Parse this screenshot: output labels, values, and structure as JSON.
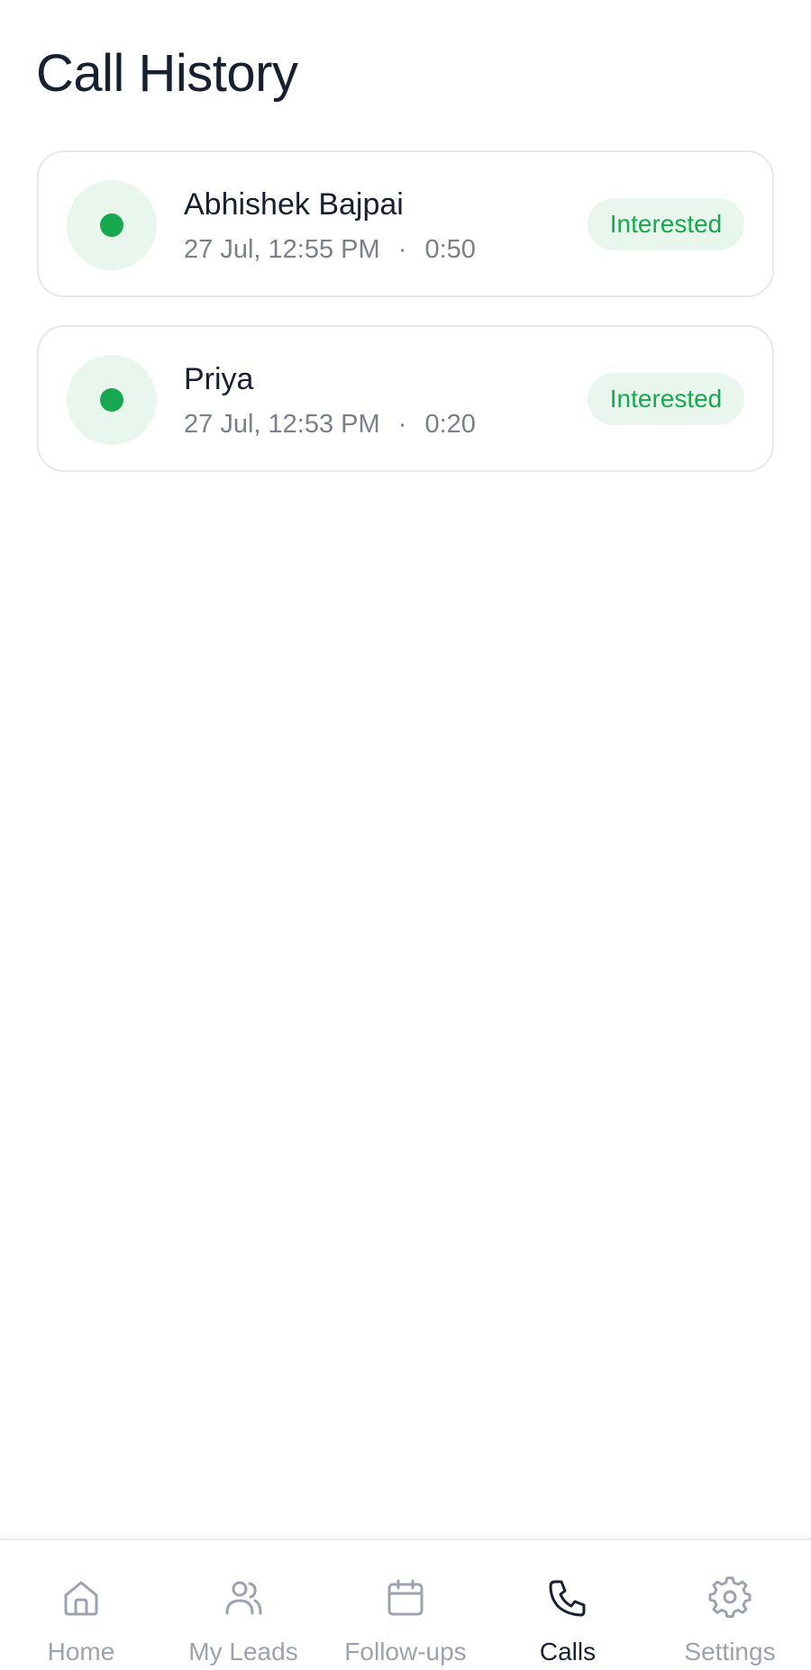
{
  "page": {
    "title": "Call History"
  },
  "colors": {
    "accent_green": "#18a84f",
    "badge_background": "#e9f6ee",
    "text_primary": "#172033",
    "text_secondary": "#7a808a",
    "nav_inactive": "#9ca3af"
  },
  "calls": [
    {
      "name": "Abhishek Bajpai",
      "datetime": "27 Jul, 12:55 PM",
      "separator": "·",
      "duration": "0:50",
      "status": "Interested",
      "indicator_icon": "green-status-dot-icon"
    },
    {
      "name": "Priya",
      "datetime": "27 Jul, 12:53 PM",
      "separator": "·",
      "duration": "0:20",
      "status": "Interested",
      "indicator_icon": "green-status-dot-icon"
    }
  ],
  "bottom_nav": {
    "items": [
      {
        "label": "Home",
        "icon": "home-icon",
        "active": false
      },
      {
        "label": "My Leads",
        "icon": "users-icon",
        "active": false
      },
      {
        "label": "Follow-ups",
        "icon": "calendar-icon",
        "active": false
      },
      {
        "label": "Calls",
        "icon": "phone-icon",
        "active": true
      },
      {
        "label": "Settings",
        "icon": "gear-icon",
        "active": false
      }
    ]
  }
}
